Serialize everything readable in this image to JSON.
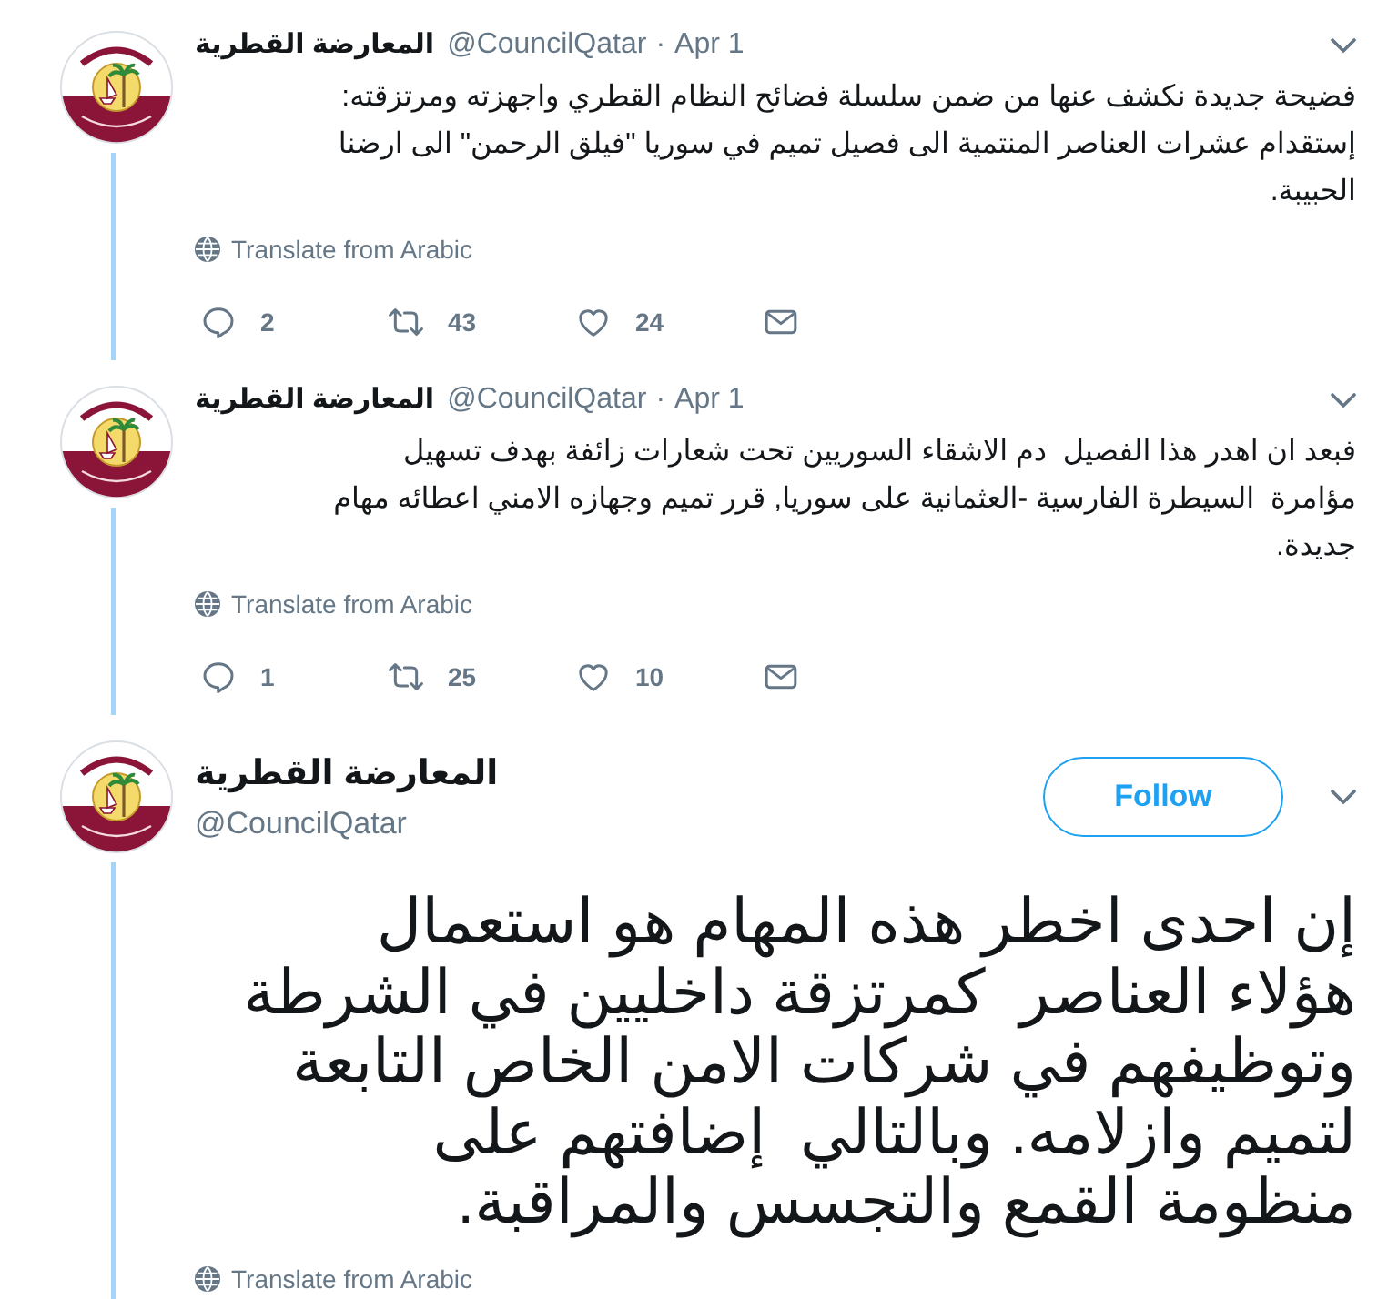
{
  "tweets": [
    {
      "kind": "compact",
      "connected_below": true,
      "author": {
        "name": "المعارضة القطرية",
        "handle": "@CouncilQatar"
      },
      "separator": "·",
      "date": "Apr 1",
      "text": "فضيحة جديدة نكشف عنها من ضمن سلسلة فضائح النظام القطري واجهزته ومرتزقته:\nإستقدام عشرات العناصر المنتمية الى فصيل تميم في سوريا \"فيلق الرحمن\" الى ارضنا\nالحبيبة.",
      "translate": "Translate from Arabic",
      "actions": {
        "replies": "2",
        "retweets": "43",
        "likes": "24"
      }
    },
    {
      "kind": "compact",
      "connected_below": true,
      "author": {
        "name": "المعارضة القطرية",
        "handle": "@CouncilQatar"
      },
      "separator": "·",
      "date": "Apr 1",
      "text": "فبعد ان اهدر هذا الفصيل  دم الاشقاء السوريين تحت شعارات زائفة بهدف تسهيل\nمؤامرة  السيطرة الفارسية -العثمانية على سوريا, قرر تميم وجهازه الامني اعطائه مهام\nجديدة.",
      "translate": "Translate from Arabic",
      "actions": {
        "replies": "1",
        "retweets": "25",
        "likes": "10"
      }
    },
    {
      "kind": "focused",
      "connected_below": true,
      "author": {
        "name": "المعارضة القطرية",
        "handle": "@CouncilQatar"
      },
      "follow": "Follow",
      "text": "إن احدى اخطر هذه المهام هو استعمال\nهؤلاء العناصر  كمرتزقة داخليين في الشرطة\nوتوظيفهم في شركات الامن الخاص التابعة\nلتميم وازلامه. وبالتالي  إضافتهم على\nمنظومة القمع والتجسس والمراقبة.",
      "translate": "Translate from Arabic"
    }
  ]
}
